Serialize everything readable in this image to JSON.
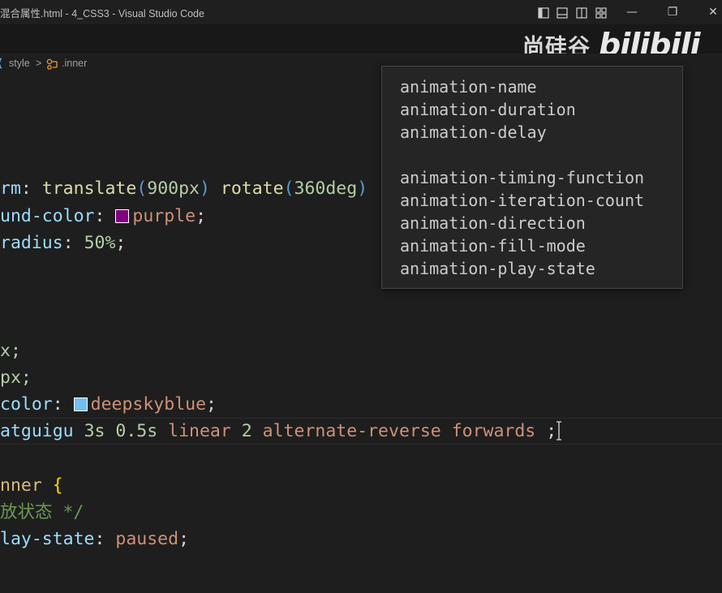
{
  "window": {
    "title": "混合属性.html - 4_CSS3 - Visual Studio Code",
    "controls": {
      "minimize": "—",
      "restore": "❐",
      "close": "✕"
    }
  },
  "watermark": {
    "brand_cn": "尚硅谷",
    "brand_bili": "bilibili"
  },
  "breadcrumb": {
    "item1": "style",
    "separator": ">",
    "item2": ".inner"
  },
  "colors": {
    "purple_swatch": "#800080",
    "deepskyblue_swatch": "#00bfff",
    "property": "#9cdcfe",
    "value_keyword": "#ce9178",
    "number": "#b5cea8",
    "function": "#dcdcaa",
    "selector": "#d7ba7d",
    "comment": "#6a9955",
    "punctuation": "#d4d4d4",
    "paren": "#569cd6"
  },
  "code": {
    "l1": {
      "prop": "rm",
      "colon": ":",
      "fn1": "translate",
      "p1o": "(",
      "num1": "900px",
      "p1c": ")",
      "fn2": "rotate",
      "p2o": "(",
      "num2": "360deg",
      "p2c": ")"
    },
    "l2": {
      "prop": "und-color",
      "colon": ":",
      "value": "purple",
      "semi": ";"
    },
    "l3": {
      "prop": "radius",
      "colon": ":",
      "value": "50%",
      "semi": ";"
    },
    "l4": {
      "text": "x;"
    },
    "l5": {
      "text": "px;"
    },
    "l6": {
      "prop": "color",
      "colon": ":",
      "value": "deepskyblue",
      "semi": ";"
    },
    "l7": {
      "name": "atguigu",
      "dur": "3s",
      "delay": "0.5s",
      "timing": "linear",
      "count": "2",
      "direction": "alternate-reverse",
      "fill": "forwards",
      "semi": ";"
    },
    "l8": {
      "selector": "nner",
      "brace": "{"
    },
    "l9": {
      "comment": "放状态 */"
    },
    "l10": {
      "prop": "lay-state",
      "colon": ":",
      "value": "paused",
      "semi": ";"
    }
  },
  "hover": {
    "lines": [
      "animation-name",
      "animation-duration",
      "animation-delay",
      "",
      "animation-timing-function",
      "animation-iteration-count",
      "animation-direction",
      "animation-fill-mode",
      "animation-play-state"
    ]
  }
}
